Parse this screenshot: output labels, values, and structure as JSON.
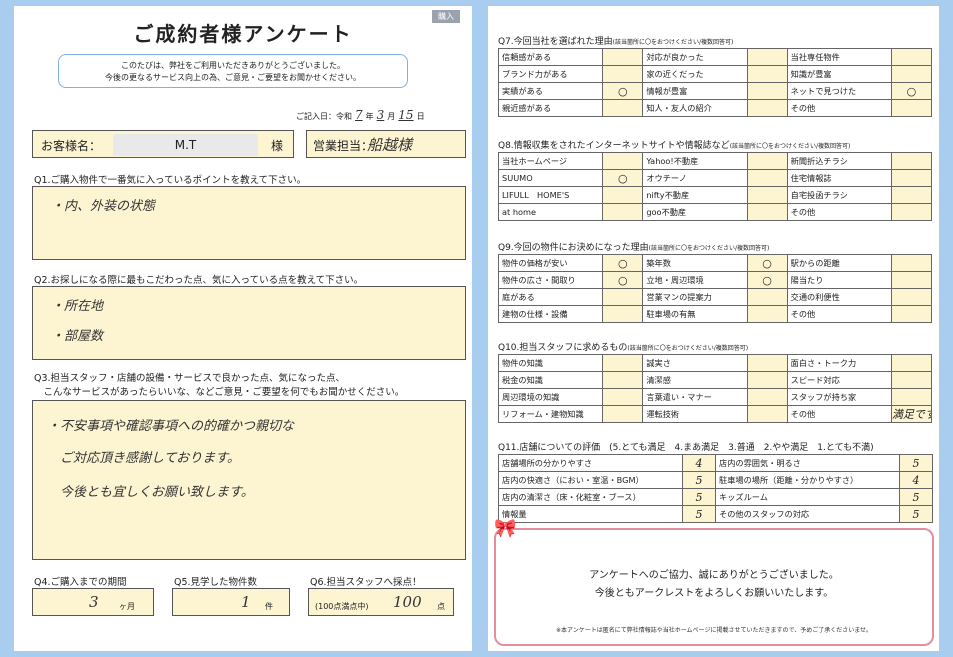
{
  "left": {
    "title": "ご成約者様アンケート",
    "corner_tag": "購入",
    "intro": [
      "このたびは、弊社をご利用いただきありがとうございました。",
      "今後の更なるサービス向上の為、ご意見・ご要望をお聞かせください。"
    ],
    "date": {
      "label": "ご記入日：令和",
      "year": "7",
      "year_unit": "年",
      "month": "3",
      "month_unit": "月",
      "day": "15",
      "day_unit": "日"
    },
    "customer": {
      "label": "お客様名：",
      "name": "M.T",
      "suffix": "様"
    },
    "staff": {
      "label": "営業担当：",
      "value": "船越様"
    },
    "q1": {
      "label": "Q1.ご購入物件で一番気に入っているポイントを教えて下さい。",
      "answer": "・内、外装の状態"
    },
    "q2": {
      "label": "Q2.お探しになる際に最もこだわった点、気に入っている点を教えて下さい。",
      "answers": [
        "・所在地",
        "・部屋数"
      ]
    },
    "q3": {
      "label_lines": [
        "Q3.担当スタッフ・店舗の設備・サービスで良かった点、気になった点、",
        "　こんなサービスがあったらいいな、などご意見・ご要望を何でもお聞かせください。"
      ],
      "answer_lines": [
        "・不安事項や確認事項への的確かつ親切な",
        "　ご対応頂き感謝しております。",
        "　今後とも宜しくお願い致します。"
      ]
    },
    "q4": {
      "label": "Q4.ご購入までの期間",
      "value": "3",
      "unit": "ヶ月"
    },
    "q5": {
      "label": "Q5.見学した物件数",
      "value": "1",
      "unit": "件"
    },
    "q6": {
      "label": "Q6.担当スタッフへ採点！",
      "prefix": "(100点満点中)",
      "value": "100",
      "unit": "点"
    }
  },
  "right": {
    "q7": {
      "label": "Q7.今回当社を選ばれた理由",
      "note": "(該当箇所に〇をおつけください/複数回答可)",
      "rows": [
        [
          [
            "信頼感がある",
            ""
          ],
          [
            "対応が良かった",
            ""
          ],
          [
            "当社専任物件",
            ""
          ]
        ],
        [
          [
            "ブランド力がある",
            ""
          ],
          [
            "家の近くだった",
            ""
          ],
          [
            "知識が豊富",
            ""
          ]
        ],
        [
          [
            "実績がある",
            "○"
          ],
          [
            "情報が豊富",
            ""
          ],
          [
            "ネットで見つけた",
            "○"
          ]
        ],
        [
          [
            "親近感がある",
            ""
          ],
          [
            "知人・友人の紹介",
            ""
          ],
          [
            "その他",
            ""
          ]
        ]
      ]
    },
    "q8": {
      "label": "Q8.情報収集をされたインターネットサイトや情報誌など",
      "note": "(該当箇所に〇をおつけください/複数回答可)",
      "rows": [
        [
          [
            "当社ホームページ",
            ""
          ],
          [
            "Yahoo!不動産",
            ""
          ],
          [
            "新聞折込チラシ",
            ""
          ]
        ],
        [
          [
            "SUUMO",
            "○"
          ],
          [
            "オウチーノ",
            ""
          ],
          [
            "住宅情報誌",
            ""
          ]
        ],
        [
          [
            "LIFULL　HOME'S",
            ""
          ],
          [
            "nifty不動産",
            ""
          ],
          [
            "自宅投函チラシ",
            ""
          ]
        ],
        [
          [
            "at home",
            ""
          ],
          [
            "goo不動産",
            ""
          ],
          [
            "その他",
            ""
          ]
        ]
      ]
    },
    "q9": {
      "label": "Q9.今回の物件にお決めになった理由",
      "note": "(該当箇所に〇をおつけください/複数回答可)",
      "rows": [
        [
          [
            "物件の価格が安い",
            "○"
          ],
          [
            "築年数",
            "○"
          ],
          [
            "駅からの距離",
            ""
          ]
        ],
        [
          [
            "物件の広さ・間取り",
            "○"
          ],
          [
            "立地・周辺環境",
            "○"
          ],
          [
            "陽当たり",
            ""
          ]
        ],
        [
          [
            "庭がある",
            ""
          ],
          [
            "営業マンの提案力",
            ""
          ],
          [
            "交通の利便性",
            ""
          ]
        ],
        [
          [
            "建物の仕様・設備",
            ""
          ],
          [
            "駐車場の有無",
            ""
          ],
          [
            "その他",
            ""
          ]
        ]
      ]
    },
    "q10": {
      "label": "Q10.担当スタッフに求めるもの",
      "note": "(該当箇所に〇をおつけください/複数回答可)",
      "rows": [
        [
          [
            "物件の知識",
            ""
          ],
          [
            "誠実さ",
            ""
          ],
          [
            "面白さ・トーク力",
            ""
          ]
        ],
        [
          [
            "税金の知識",
            ""
          ],
          [
            "清潔感",
            ""
          ],
          [
            "スピード対応",
            ""
          ]
        ],
        [
          [
            "周辺環境の知識",
            ""
          ],
          [
            "言葉遣い・マナー",
            ""
          ],
          [
            "スタッフが持ち家",
            ""
          ]
        ],
        [
          [
            "リフォーム・建物知識",
            ""
          ],
          [
            "運転技術",
            ""
          ],
          [
            "その他",
            "満足です"
          ]
        ]
      ]
    },
    "q11": {
      "label": "Q11.店舗についての評価",
      "scale": "(5.とても満足　4.まあ満足　3.普通　2.やや満足　1.とても不満)",
      "rows": [
        [
          [
            "店舗場所の分かりやすさ",
            "4"
          ],
          [
            "店内の雰囲気・明るさ",
            "5"
          ]
        ],
        [
          [
            "店内の快適さ（におい・室温・BGM）",
            "5"
          ],
          [
            "駐車場の場所（距離・分かりやすさ）",
            "4"
          ]
        ],
        [
          [
            "店内の清潔さ（床・化粧室・ブース）",
            "5"
          ],
          [
            "キッズルーム",
            "5"
          ]
        ],
        [
          [
            "情報量",
            "5"
          ],
          [
            "その他のスタッフの対応",
            "5"
          ]
        ]
      ]
    },
    "thanks": {
      "line1": "アンケートへのご協力、誠にありがとうございました。",
      "line2": "今後ともアークレストをよろしくお願いいたします。",
      "footnote": "※本アンケートは匿名にて弊社情報誌や当社ホームページに掲載させていただきますので、予めご了承くださいませ。"
    }
  }
}
